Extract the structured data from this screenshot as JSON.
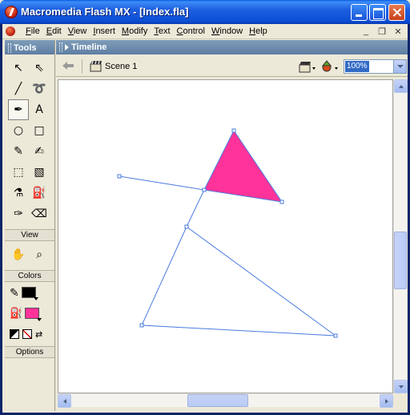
{
  "window": {
    "title": "Macromedia Flash MX - [Index.fla]"
  },
  "menu": [
    "File",
    "Edit",
    "View",
    "Insert",
    "Modify",
    "Text",
    "Control",
    "Window",
    "Help"
  ],
  "mdi_controls": {
    "minimize": "_",
    "restore": "❐",
    "close": "✕"
  },
  "tools_panel": {
    "title": "Tools",
    "tools": [
      {
        "name": "arrow-tool",
        "glyph": "↖"
      },
      {
        "name": "subselect-tool",
        "glyph": "⇖"
      },
      {
        "name": "line-tool",
        "glyph": "╱"
      },
      {
        "name": "lasso-tool",
        "glyph": "➰"
      },
      {
        "name": "pen-tool",
        "glyph": "✒"
      },
      {
        "name": "text-tool",
        "glyph": "A"
      },
      {
        "name": "oval-tool",
        "glyph": "○"
      },
      {
        "name": "rectangle-tool",
        "glyph": "□"
      },
      {
        "name": "pencil-tool",
        "glyph": "✎"
      },
      {
        "name": "brush-tool",
        "glyph": "✍"
      },
      {
        "name": "free-transform-tool",
        "glyph": "⬚"
      },
      {
        "name": "fill-transform-tool",
        "glyph": "▧"
      },
      {
        "name": "ink-bottle-tool",
        "glyph": "⚗"
      },
      {
        "name": "paint-bucket-tool",
        "glyph": "⛽"
      },
      {
        "name": "eyedropper-tool",
        "glyph": "✑"
      },
      {
        "name": "eraser-tool",
        "glyph": "⌫"
      }
    ],
    "view_label": "View",
    "view_tools": [
      {
        "name": "hand-tool",
        "glyph": "✋"
      },
      {
        "name": "zoom-tool",
        "glyph": "⌕"
      }
    ],
    "colors_label": "Colors",
    "stroke_color": "#000000",
    "fill_color": "#FF3399",
    "options_label": "Options"
  },
  "timeline": {
    "title": "Timeline"
  },
  "scene": {
    "label": "Scene 1",
    "zoom": "100%"
  },
  "stage": {
    "background": "#FFFFFF",
    "stroke_color": "#4A7BE0",
    "fill_color": "#FF3399"
  }
}
